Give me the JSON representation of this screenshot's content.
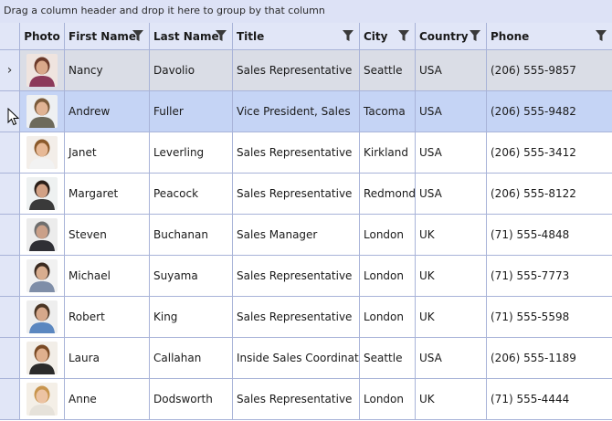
{
  "group_panel": {
    "text": "Drag a column header and drop it here to group by that column"
  },
  "columns": {
    "photo": "Photo",
    "first_name": "First Name",
    "last_name": "Last Name",
    "title": "Title",
    "city": "City",
    "country": "Country",
    "phone": "Phone"
  },
  "rows": [
    {
      "first": "Nancy",
      "last": "Davolio",
      "title": "Sales Representative",
      "city": "Seattle",
      "country": "USA",
      "phone": "(206) 555-9857"
    },
    {
      "first": "Andrew",
      "last": "Fuller",
      "title": "Vice President, Sales",
      "city": "Tacoma",
      "country": "USA",
      "phone": "(206) 555-9482"
    },
    {
      "first": "Janet",
      "last": "Leverling",
      "title": "Sales Representative",
      "city": "Kirkland",
      "country": "USA",
      "phone": "(206) 555-3412"
    },
    {
      "first": "Margaret",
      "last": "Peacock",
      "title": "Sales Representative",
      "city": "Redmond",
      "country": "USA",
      "phone": "(206) 555-8122"
    },
    {
      "first": "Steven",
      "last": "Buchanan",
      "title": "Sales Manager",
      "city": "London",
      "country": "UK",
      "phone": "(71) 555-4848"
    },
    {
      "first": "Michael",
      "last": "Suyama",
      "title": "Sales Representative",
      "city": "London",
      "country": "UK",
      "phone": "(71) 555-7773"
    },
    {
      "first": "Robert",
      "last": "King",
      "title": "Sales Representative",
      "city": "London",
      "country": "UK",
      "phone": "(71) 555-5598"
    },
    {
      "first": "Laura",
      "last": "Callahan",
      "title": "Inside Sales Coordinator",
      "city": "Seattle",
      "country": "USA",
      "phone": "(206) 555-1189"
    },
    {
      "first": "Anne",
      "last": "Dodsworth",
      "title": "Sales Representative",
      "city": "London",
      "country": "UK",
      "phone": "(71) 555-4444"
    }
  ],
  "colors": {
    "header_bg": "#e1e6f7",
    "selected_row": "#dadde6",
    "hover_row": "#c5d4f5",
    "grid_line": "#a8b3d8"
  },
  "icons": {
    "filter": "filter-funnel-icon",
    "current_row": "chevron-right-icon",
    "pointer": "mouse-pointer-icon"
  }
}
